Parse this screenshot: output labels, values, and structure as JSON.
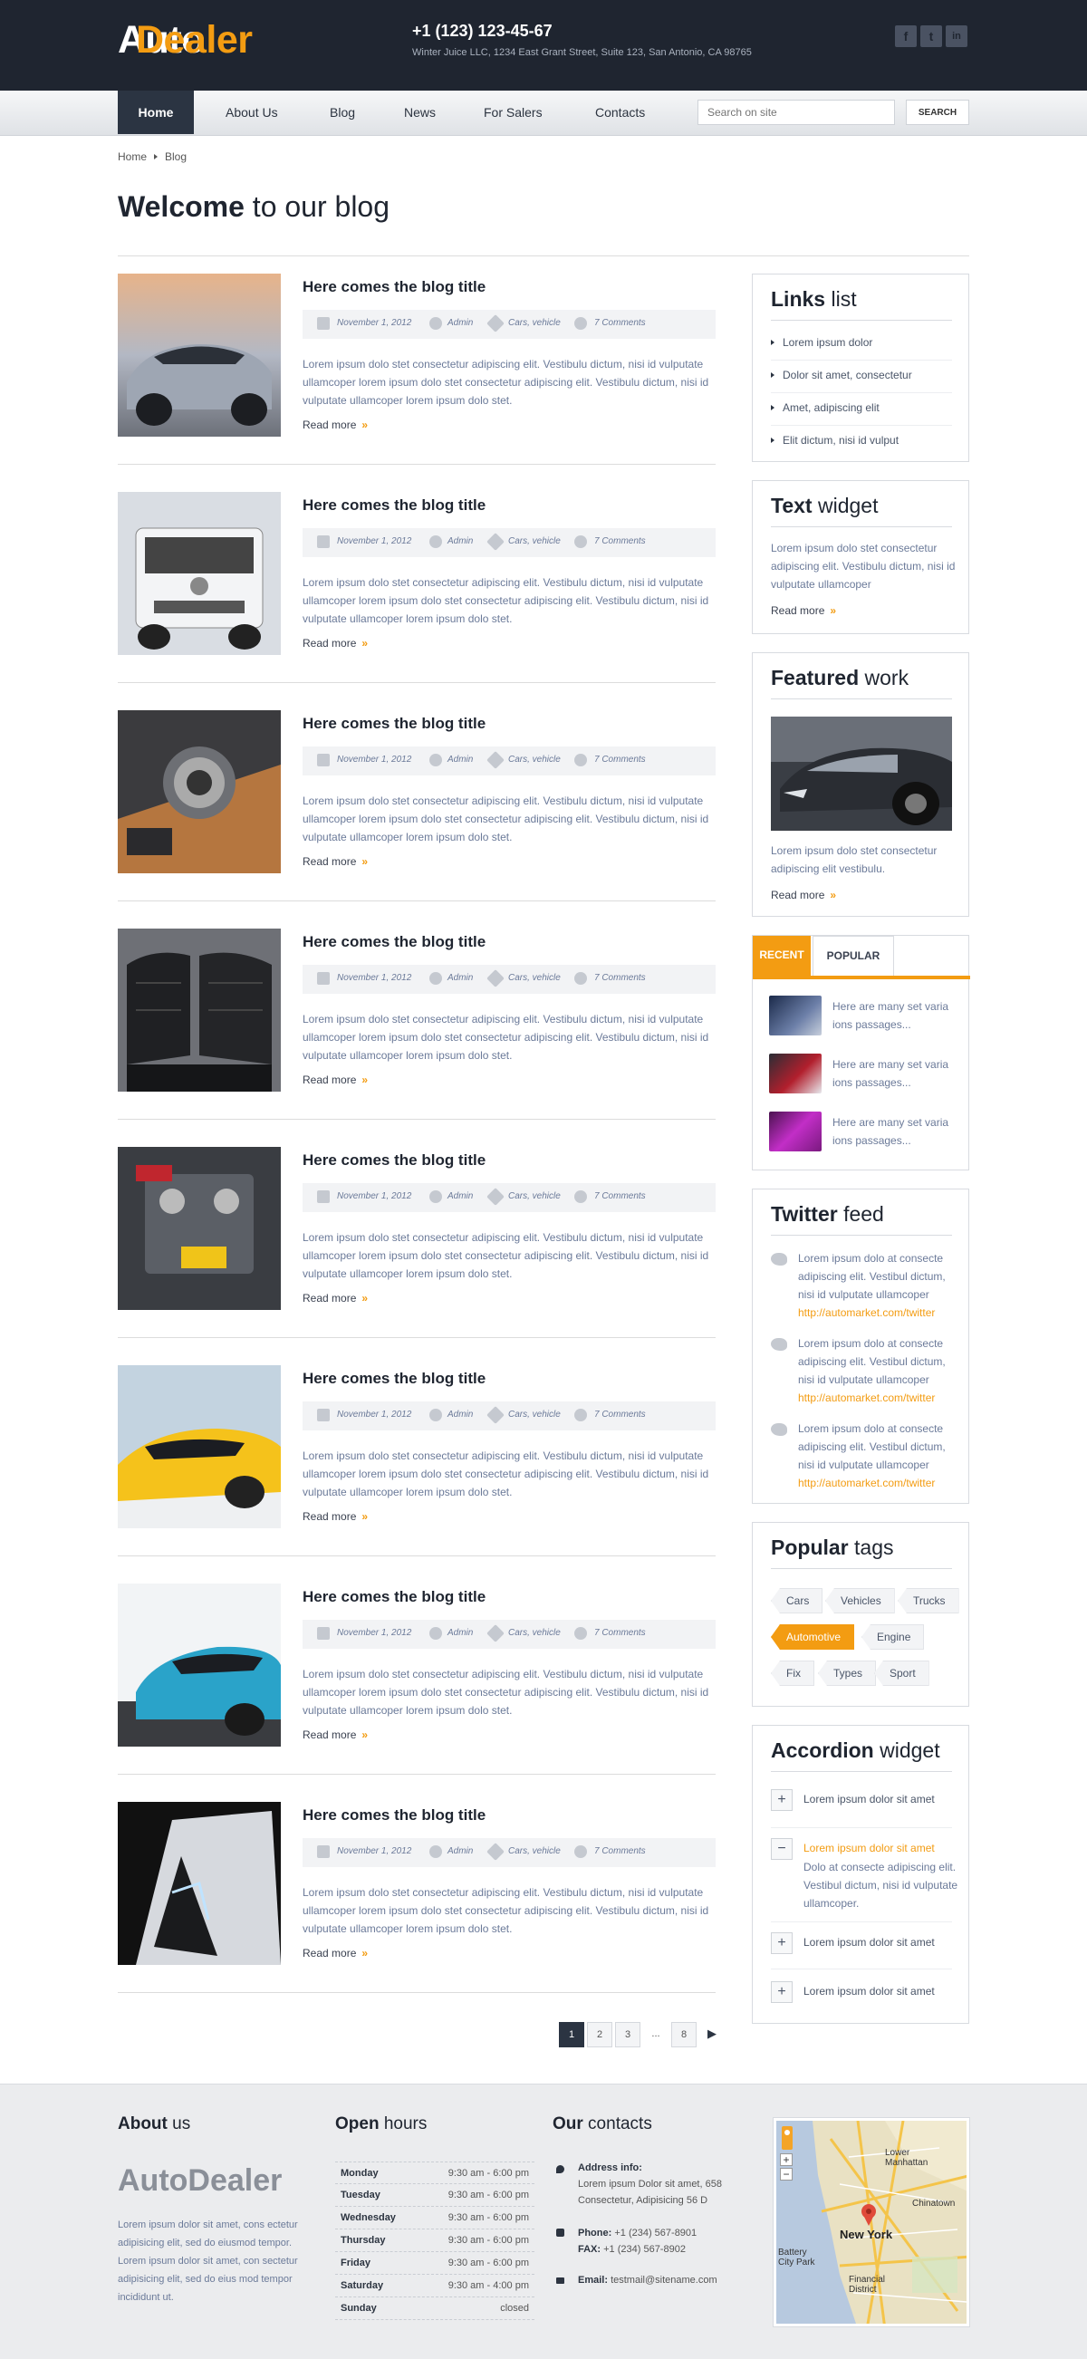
{
  "header": {
    "logo_a": "Auto",
    "logo_b": "Dealer",
    "phone": "+1 (123) 123-45-67",
    "address": "Winter Juice LLC, 1234 East Grant Street, Suite 123, San Antonio, CA 98765",
    "social": [
      "f",
      "t",
      "in"
    ]
  },
  "nav": {
    "items": [
      "Home",
      "About Us",
      "Blog",
      "News",
      "For Salers",
      "Contacts"
    ],
    "search_placeholder": "Search on site",
    "search_button": "SEARCH"
  },
  "breadcrumb": [
    "Home",
    "Blog"
  ],
  "page_title_bold": "Welcome",
  "page_title_rest": " to our blog",
  "posts": [
    {
      "title": "Here comes the blog title",
      "date": "November 1, 2012",
      "author": "Admin",
      "cats": "Cars, vehicle",
      "comments": "7 Comments",
      "excerpt": "Lorem ipsum dolo stet consectetur adipiscing elit. Vestibulu dictum, nisi id vulputate ullamcoper lorem ipsum dolo stet consectetur adipiscing elit. Vestibulu dictum, nisi id vulputate ullamcoper lorem ipsum dolo stet.",
      "read_more": "Read more"
    },
    {
      "title": "Here comes the blog title",
      "date": "November 1, 2012",
      "author": "Admin",
      "cats": "Cars, vehicle",
      "comments": "7 Comments",
      "excerpt": "Lorem ipsum dolo stet consectetur adipiscing elit. Vestibulu dictum, nisi id vulputate ullamcoper lorem ipsum dolo stet consectetur adipiscing elit. Vestibulu dictum, nisi id vulputate ullamcoper lorem ipsum dolo stet.",
      "read_more": "Read more"
    },
    {
      "title": "Here comes the blog title",
      "date": "November 1, 2012",
      "author": "Admin",
      "cats": "Cars, vehicle",
      "comments": "7 Comments",
      "excerpt": "Lorem ipsum dolo stet consectetur adipiscing elit. Vestibulu dictum, nisi id vulputate ullamcoper lorem ipsum dolo stet consectetur adipiscing elit. Vestibulu dictum, nisi id vulputate ullamcoper lorem ipsum dolo stet.",
      "read_more": "Read more"
    },
    {
      "title": "Here comes the blog title",
      "date": "November 1, 2012",
      "author": "Admin",
      "cats": "Cars, vehicle",
      "comments": "7 Comments",
      "excerpt": "Lorem ipsum dolo stet consectetur adipiscing elit. Vestibulu dictum, nisi id vulputate ullamcoper lorem ipsum dolo stet consectetur adipiscing elit. Vestibulu dictum, nisi id vulputate ullamcoper lorem ipsum dolo stet.",
      "read_more": "Read more"
    },
    {
      "title": "Here comes the blog title",
      "date": "November 1, 2012",
      "author": "Admin",
      "cats": "Cars, vehicle",
      "comments": "7 Comments",
      "excerpt": "Lorem ipsum dolo stet consectetur adipiscing elit. Vestibulu dictum, nisi id vulputate ullamcoper lorem ipsum dolo stet consectetur adipiscing elit. Vestibulu dictum, nisi id vulputate ullamcoper lorem ipsum dolo stet.",
      "read_more": "Read more"
    },
    {
      "title": "Here comes the blog title",
      "date": "November 1, 2012",
      "author": "Admin",
      "cats": "Cars, vehicle",
      "comments": "7 Comments",
      "excerpt": "Lorem ipsum dolo stet consectetur adipiscing elit. Vestibulu dictum, nisi id vulputate ullamcoper lorem ipsum dolo stet consectetur adipiscing elit. Vestibulu dictum, nisi id vulputate ullamcoper lorem ipsum dolo stet.",
      "read_more": "Read more"
    },
    {
      "title": "Here comes the blog title",
      "date": "November 1, 2012",
      "author": "Admin",
      "cats": "Cars, vehicle",
      "comments": "7 Comments",
      "excerpt": "Lorem ipsum dolo stet consectetur adipiscing elit. Vestibulu dictum, nisi id vulputate ullamcoper lorem ipsum dolo stet consectetur adipiscing elit. Vestibulu dictum, nisi id vulputate ullamcoper lorem ipsum dolo stet.",
      "read_more": "Read more"
    },
    {
      "title": "Here comes the blog title",
      "date": "November 1, 2012",
      "author": "Admin",
      "cats": "Cars, vehicle",
      "comments": "7 Comments",
      "excerpt": "Lorem ipsum dolo stet consectetur adipiscing elit. Vestibulu dictum, nisi id vulputate ullamcoper lorem ipsum dolo stet consectetur adipiscing elit. Vestibulu dictum, nisi id vulputate ullamcoper lorem ipsum dolo stet.",
      "read_more": "Read more"
    }
  ],
  "pagination": [
    "1",
    "2",
    "3",
    "...",
    "8"
  ],
  "sidebar": {
    "links": {
      "title_b": "Links",
      "title_r": " list",
      "items": [
        "Lorem ipsum dolor",
        "Dolor sit amet, consectetur",
        "Amet, adipiscing elit",
        "Elit dictum, nisi id vulput"
      ]
    },
    "text": {
      "title_b": "Text",
      "title_r": " widget",
      "body": "Lorem ipsum dolo stet consectetur adipiscing elit. Vestibulu dictum, nisi id vulputate ullamcoper",
      "read_more": "Read more"
    },
    "featured": {
      "title_b": "Featured",
      "title_r": " work",
      "body": "Lorem ipsum dolo stet consectetur adipiscing elit vestibulu.",
      "read_more": "Read more"
    },
    "tabs": {
      "labels": [
        "RECENT",
        "POPULAR"
      ],
      "items": [
        "Here are many set varia ions passages...",
        "Here are many set varia ions passages...",
        "Here are many set varia ions passages..."
      ]
    },
    "twitter": {
      "title_b": "Twitter",
      "title_r": " feed",
      "tweets": [
        {
          "text": "Lorem ipsum dolo at consecte adipiscing elit. Vestibul dictum, nisi id vulputate ullamcoper",
          "link": "http://automarket.com/twitter"
        },
        {
          "text": "Lorem ipsum dolo at consecte adipiscing elit. Vestibul dictum, nisi id vulputate ullamcoper",
          "link": "http://automarket.com/twitter"
        },
        {
          "text": "Lorem ipsum dolo at consecte adipiscing elit. Vestibul dictum, nisi id vulputate ullamcoper",
          "link": "http://automarket.com/twitter"
        }
      ]
    },
    "tags": {
      "title_b": "Popular",
      "title_r": " tags",
      "items": [
        "Cars",
        "Vehicles",
        "Trucks",
        "Automotive",
        "Engine",
        "Fix",
        "Types",
        "Sport"
      ],
      "active": "Automotive"
    },
    "accordion": {
      "title_b": "Accordion",
      "title_r": " widget",
      "items": [
        {
          "title": "Lorem ipsum dolor sit amet",
          "sign": "+"
        },
        {
          "title": "Lorem ipsum dolor sit amet",
          "sign": "−",
          "body": "Dolo at consecte adipiscing elit. Vestibul dictum, nisi id vulputate ullamcoper."
        },
        {
          "title": "Lorem ipsum dolor sit amet",
          "sign": "+"
        },
        {
          "title": "Lorem ipsum dolor sit amet",
          "sign": "+"
        }
      ]
    }
  },
  "footer": {
    "about": {
      "title_b": "About",
      "title_r": " us",
      "logo": "AutoDealer",
      "text": "Lorem ipsum dolor sit amet, cons ectetur adipisicing elit, sed do eiusmod tempor. Lorem ipsum dolor sit amet, con sectetur adipisicing elit, sed do eius mod tempor incididunt ut."
    },
    "hours": {
      "title_b": "Open",
      "title_r": " hours",
      "rows": [
        {
          "day": "Monday",
          "time": "9:30 am - 6:00 pm"
        },
        {
          "day": "Tuesday",
          "time": "9:30 am - 6:00 pm"
        },
        {
          "day": "Wednesday",
          "time": "9:30 am - 6:00 pm"
        },
        {
          "day": "Thursday",
          "time": "9:30 am - 6:00 pm"
        },
        {
          "day": "Friday",
          "time": "9:30 am - 6:00 pm"
        },
        {
          "day": "Saturday",
          "time": "9:30 am - 4:00 pm"
        },
        {
          "day": "Sunday",
          "time": "closed"
        }
      ]
    },
    "contacts": {
      "title_b": "Our",
      "title_r": " contacts",
      "address_label": "Address info:",
      "address": "Lorem ipsum Dolor sit amet, 658 Consectetur, Adipisicing 56 D",
      "phone_label": "Phone:",
      "phone": "+1 (234) 567-8901",
      "fax_label": "FAX:",
      "fax": "+1 (234) 567-8902",
      "email_label": "Email:",
      "email": "testmail@sitename.com"
    },
    "map": {
      "labels": [
        "Lower Manhattan",
        "Chinatown",
        "New York",
        "Battery City Park",
        "Financial District"
      ],
      "zoom": [
        "+",
        "−"
      ]
    }
  },
  "colors": {
    "accent": "#f39c12",
    "dark": "#1f2530",
    "nav_active": "#2b3442"
  }
}
